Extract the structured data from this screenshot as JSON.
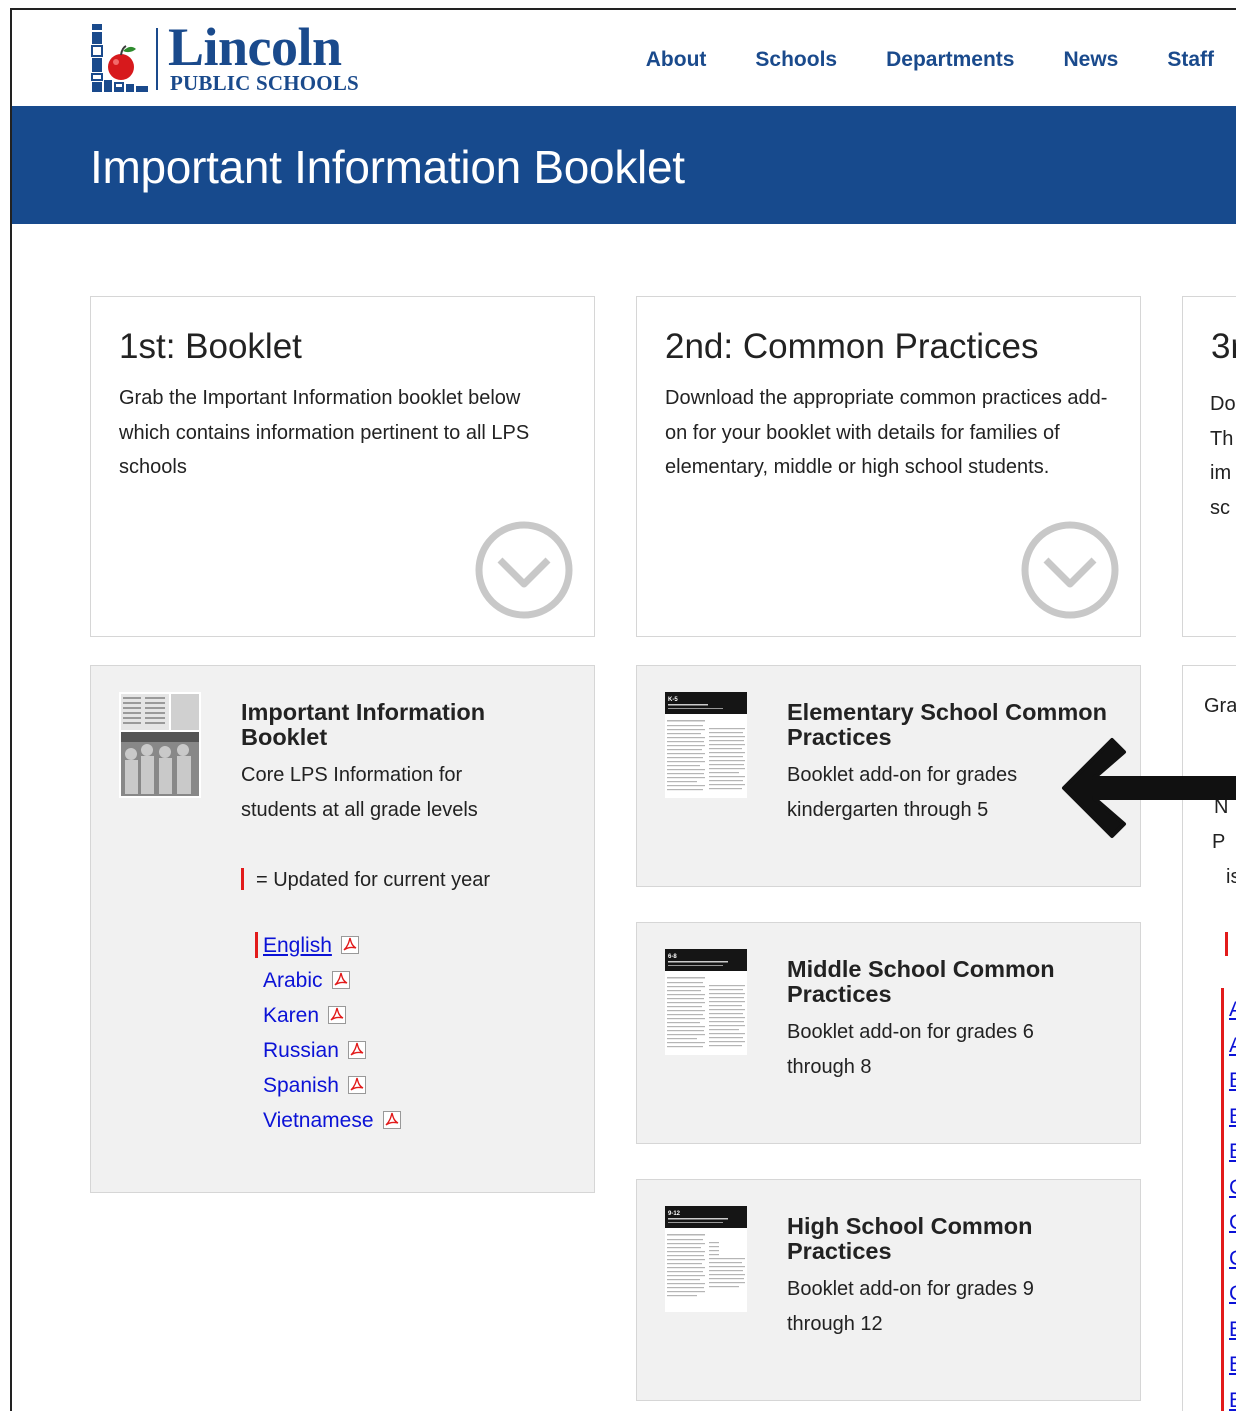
{
  "header": {
    "logo_name": "Lincoln",
    "logo_sub": "PUBLIC SCHOOLS",
    "nav": [
      "About",
      "Schools",
      "Departments",
      "News",
      "Staff"
    ]
  },
  "banner": {
    "title": "Important Information Booklet"
  },
  "steps": [
    {
      "title": "1st: Booklet",
      "text": "Grab the Important Information booklet below which contains information pertinent to all LPS schools",
      "icon": "chevron-circle-down-icon"
    },
    {
      "title": "2nd: Common Practices",
      "text": "Download the appropriate common practices add-on for your booklet with details for families of elementary, middle or high school students.",
      "icon": "chevron-circle-down-icon"
    },
    {
      "title_partial": "3r",
      "lines_partial": [
        "Do",
        "Th",
        "im",
        "sc"
      ]
    }
  ],
  "booklet_card": {
    "title": "Important Information Booklet",
    "desc": "Core LPS Information for students at all grade levels",
    "legend": "= Updated for current year",
    "languages": [
      {
        "label": "English",
        "updated": true
      },
      {
        "label": "Arabic",
        "updated": false
      },
      {
        "label": "Karen",
        "updated": false
      },
      {
        "label": "Russian",
        "updated": false
      },
      {
        "label": "Spanish",
        "updated": false
      },
      {
        "label": "Vietnamese",
        "updated": false
      }
    ]
  },
  "practice_cards": [
    {
      "title": "Elementary School Common Practices",
      "desc": "Booklet add-on for grades kindergarten through 5",
      "thumb_label": "K-5"
    },
    {
      "title": "Middle School Common Practices",
      "desc": "Booklet add-on for grades 6 through 8",
      "thumb_label": "6-8"
    },
    {
      "title": "High School Common Practices",
      "desc": "Booklet add-on for grades 9 through 12",
      "thumb_label": "9-12"
    }
  ],
  "third_card_partial": {
    "label": "Gra",
    "lines": [
      "N",
      "P",
      "is"
    ],
    "links": [
      "A",
      "A",
      "B",
      "B",
      "B",
      "C",
      "C",
      "C",
      "C",
      "E",
      "E",
      "E"
    ]
  },
  "colors": {
    "brand_blue": "#174a8d",
    "link_blue": "#0b12d6",
    "update_red": "#e21b1b",
    "card_gray": "#f1f1f1"
  }
}
